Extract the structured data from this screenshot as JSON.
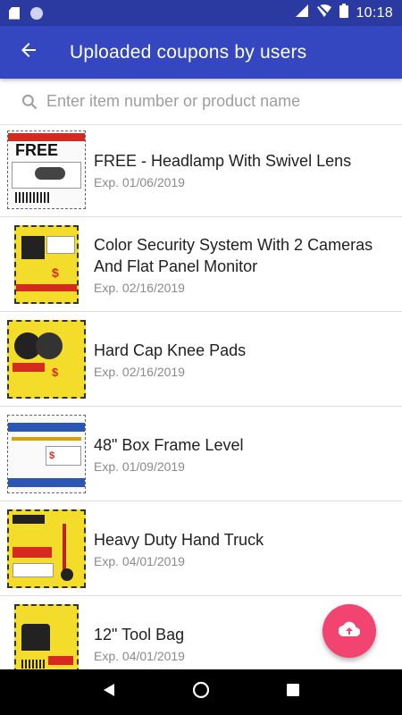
{
  "status_bar": {
    "time": "10:18"
  },
  "app_bar": {
    "title": "Uploaded coupons by users"
  },
  "search": {
    "placeholder": "Enter item number or product name",
    "value": ""
  },
  "coupons": [
    {
      "title": "FREE - Headlamp With Swivel Lens",
      "expiry": "Exp. 01/06/2019"
    },
    {
      "title": "Color Security System With 2 Cameras And Flat Panel Monitor",
      "expiry": "Exp. 02/16/2019"
    },
    {
      "title": "Hard Cap Knee Pads",
      "expiry": "Exp. 02/16/2019"
    },
    {
      "title": "48\" Box Frame Level",
      "expiry": "Exp. 01/09/2019"
    },
    {
      "title": "Heavy Duty Hand Truck",
      "expiry": "Exp. 04/01/2019"
    },
    {
      "title": "12\" Tool Bag",
      "expiry": "Exp. 04/01/2019"
    }
  ],
  "colors": {
    "status_bar": "#2a3aa0",
    "app_bar": "#3446c0",
    "fab": "#f24470",
    "coupon_yellow": "#f3dd2a",
    "coupon_red": "#d62a20"
  },
  "icons": {
    "back": "arrow-back-icon",
    "search": "search-icon",
    "fab": "cloud-upload-icon",
    "nav_back": "triangle-back-icon",
    "nav_home": "circle-home-icon",
    "nav_recents": "square-recents-icon"
  }
}
